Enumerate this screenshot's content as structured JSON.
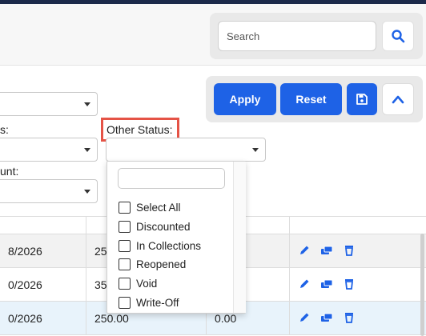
{
  "search": {
    "placeholder": "Search"
  },
  "actions": {
    "apply_label": "Apply",
    "reset_label": "Reset"
  },
  "filters": {
    "status_label_partial": "s:",
    "amount_label_partial": "unt:",
    "other_status_label": "Other Status:"
  },
  "other_status_dropdown": {
    "options": [
      "Select All",
      "Discounted",
      "In Collections",
      "Reopened",
      "Void",
      "Write-Off"
    ]
  },
  "table": {
    "rows": [
      {
        "date": "8/2026",
        "amount": "25",
        "balance": ""
      },
      {
        "date": "0/2026",
        "amount": "35",
        "balance": ""
      },
      {
        "date": "0/2026",
        "amount": "250.00",
        "balance": "0.00"
      }
    ]
  },
  "colors": {
    "accent": "#1e62e6",
    "highlight_border": "#e55346",
    "selected_row": "#e8f3fb",
    "row_alt": "#f2f2f2"
  }
}
